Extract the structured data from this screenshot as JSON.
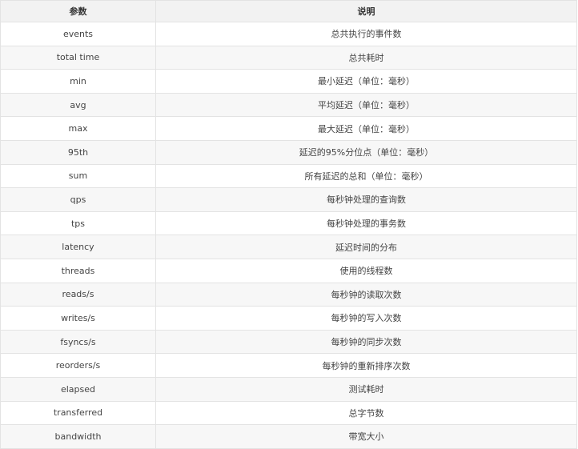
{
  "table": {
    "headers": [
      "参数",
      "说明"
    ],
    "rows": [
      {
        "param": "events",
        "desc": "总共执行的事件数"
      },
      {
        "param": "total time",
        "desc": "总共耗时"
      },
      {
        "param": "min",
        "desc": "最小延迟（单位：毫秒）"
      },
      {
        "param": "avg",
        "desc": "平均延迟（单位：毫秒）"
      },
      {
        "param": "max",
        "desc": "最大延迟（单位：毫秒）"
      },
      {
        "param": "95th",
        "desc": "延迟的95%分位点（单位：毫秒）"
      },
      {
        "param": "sum",
        "desc": "所有延迟的总和（单位：毫秒）"
      },
      {
        "param": "qps",
        "desc": "每秒钟处理的查询数"
      },
      {
        "param": "tps",
        "desc": "每秒钟处理的事务数"
      },
      {
        "param": "latency",
        "desc": "延迟时间的分布"
      },
      {
        "param": "threads",
        "desc": "使用的线程数"
      },
      {
        "param": "reads/s",
        "desc": "每秒钟的读取次数"
      },
      {
        "param": "writes/s",
        "desc": "每秒钟的写入次数"
      },
      {
        "param": "fsyncs/s",
        "desc": "每秒钟的同步次数"
      },
      {
        "param": "reorders/s",
        "desc": "每秒钟的重新排序次数"
      },
      {
        "param": "elapsed",
        "desc": "测试耗时"
      },
      {
        "param": "transferred",
        "desc": "总字节数"
      },
      {
        "param": "bandwidth",
        "desc": "带宽大小"
      }
    ]
  }
}
